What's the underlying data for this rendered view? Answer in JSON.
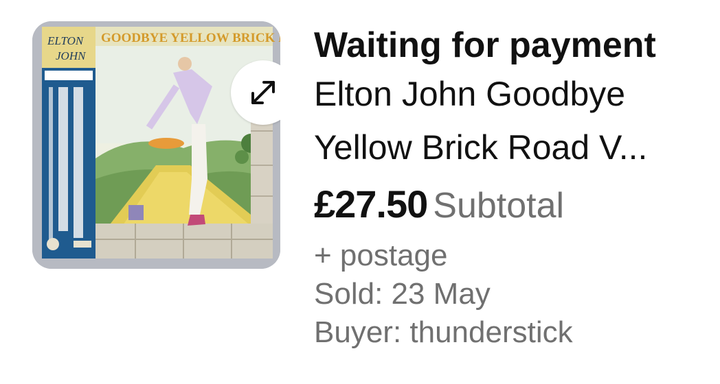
{
  "listing": {
    "status": "Waiting for payment",
    "title_line1": "Elton John Goodbye",
    "title_line2": "Yellow Brick Road V...",
    "price": "£27.50",
    "price_suffix": "Subtotal",
    "postage": "+ postage",
    "sold": "Sold: 23 May",
    "buyer": "Buyer: thunderstick"
  },
  "thumbnail": {
    "cover_text_logo_line1": "ELTON",
    "cover_text_logo_line2": "JOHN",
    "cover_text_title": "GOODBYE YELLOW BRICK ROAD",
    "icon": "expand-icon"
  },
  "colors": {
    "text_primary": "#111111",
    "text_secondary": "#707070",
    "obi_blue": "#1f5b8f"
  }
}
